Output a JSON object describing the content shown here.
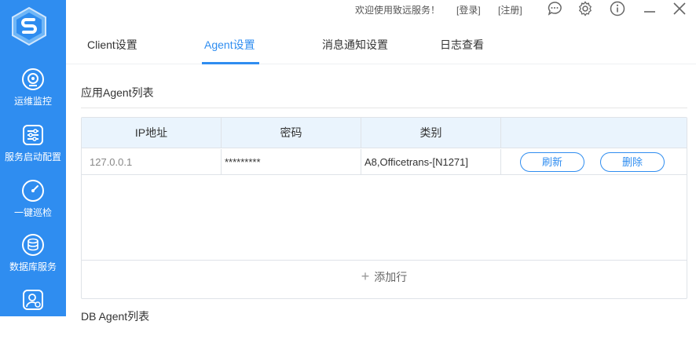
{
  "sidebar": {
    "items": [
      {
        "label": "运维监控",
        "icon": "webcam-icon"
      },
      {
        "label": "服务启动配置",
        "icon": "sliders-icon"
      },
      {
        "label": "一键巡检",
        "icon": "gauge-icon"
      },
      {
        "label": "数据库服务",
        "icon": "database-icon"
      },
      {
        "label": "",
        "icon": "user-shield-icon"
      }
    ]
  },
  "topbar": {
    "welcome": "欢迎使用致远服务！",
    "login": "[登录]",
    "register": "[注册]"
  },
  "tabs": [
    {
      "label": "Client设置",
      "active": false
    },
    {
      "label": "Agent设置",
      "active": true
    },
    {
      "label": "消息通知设置",
      "active": false
    },
    {
      "label": "日志查看",
      "active": false
    }
  ],
  "section": {
    "title": "应用Agent列表",
    "columns": [
      "IP地址",
      "密码",
      "类别",
      ""
    ],
    "rows": [
      {
        "ip": "127.0.0.1",
        "password": "*********",
        "category": "A8,Officetrans-[N1271]",
        "refresh": "刷新",
        "delete": "删除"
      }
    ],
    "add_row": "添加行"
  },
  "next_section": {
    "title": "DB Agent列表"
  },
  "colors": {
    "accent": "#2f8df0",
    "header_bg": "#eaf4fd"
  }
}
